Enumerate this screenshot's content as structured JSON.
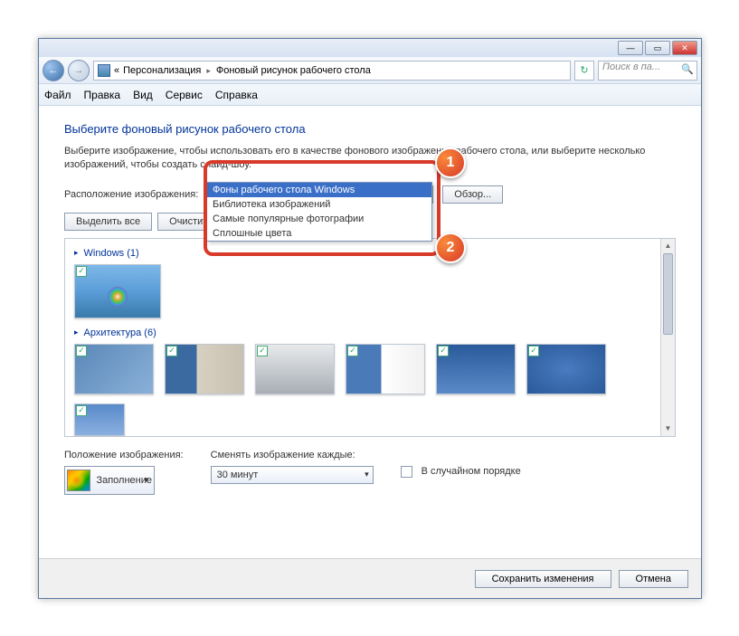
{
  "breadcrumb": {
    "prefix": "«",
    "item1": "Персонализация",
    "item2": "Фоновый рисунок рабочего стола"
  },
  "search": {
    "placeholder": "Поиск в па..."
  },
  "menu": {
    "file": "Файл",
    "edit": "Правка",
    "view": "Вид",
    "service": "Сервис",
    "help": "Справка"
  },
  "content": {
    "heading": "Выберите фоновый рисунок рабочего стола",
    "desc": "Выберите изображение, чтобы использовать его в качестве фонового изображения рабочего стола, или выберите несколько изображений, чтобы создать слайд-шоу.",
    "loc_label": "Расположение изображения:",
    "loc_value": "Фоны рабочего стола Windows",
    "browse": "Обзор...",
    "select_all": "Выделить все",
    "clear_all": "Очистить все"
  },
  "dropdown": {
    "opt1": "Фоны рабочего стола Windows",
    "opt2": "Библиотека изображений",
    "opt3": "Самые популярные фотографии",
    "opt4": "Сплошные цвета"
  },
  "groups": {
    "g1": "Windows (1)",
    "g2": "Архитектура (6)"
  },
  "bottom": {
    "pos_label": "Положение изображения:",
    "pos_value": "Заполнение",
    "change_label": "Сменять изображение каждые:",
    "change_value": "30 минут",
    "random": "В случайном порядке"
  },
  "footer": {
    "save": "Сохранить изменения",
    "cancel": "Отмена"
  },
  "callouts": {
    "c1": "1",
    "c2": "2"
  }
}
